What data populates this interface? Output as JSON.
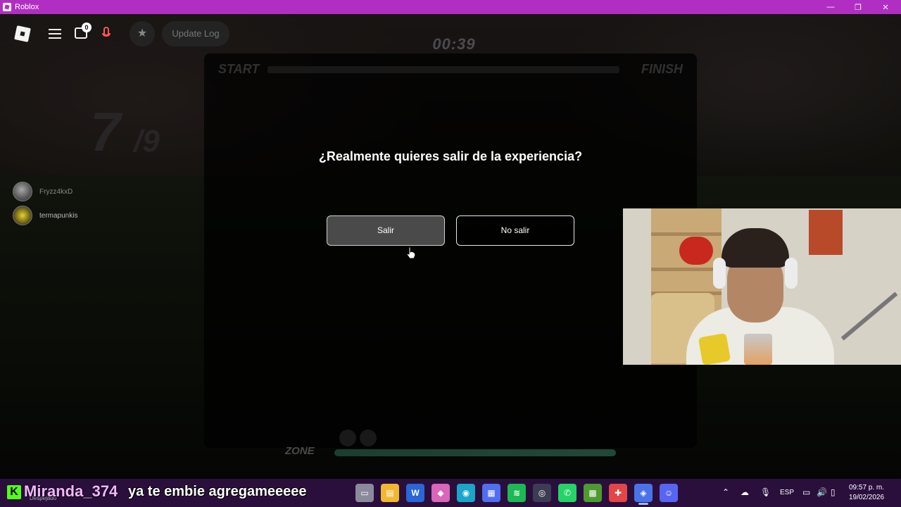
{
  "window": {
    "title": "Roblox",
    "minimize": "—",
    "restore": "❐",
    "close": "✕"
  },
  "hud": {
    "chat_badge": "0",
    "update_log": "Update Log",
    "timer": "00:39",
    "start_label": "START",
    "finish_label": "FINISH",
    "counter_num": "7",
    "counter_den": "/9",
    "zone_label": "ZONE"
  },
  "players": [
    {
      "name": "Fryzz4kxD"
    },
    {
      "name": "termapunkis"
    }
  ],
  "dialog": {
    "title": "¿Realmente quieres salir de la experiencia?",
    "exit_label": "Salir",
    "stay_label": "No salir"
  },
  "stream_chat": {
    "badge": "K",
    "username": "Miranda_374",
    "message": "ya te embie agregameeeee"
  },
  "taskbar": {
    "weather_label": "Despejado",
    "apps": [
      {
        "icon": "file-explorer-icon",
        "color": "#f0b732"
      },
      {
        "icon": "word-icon",
        "color": "#2b66d4"
      },
      {
        "icon": "copilot-icon",
        "color": "#d966b8"
      },
      {
        "icon": "edge-icon",
        "color": "#1aa5c9"
      },
      {
        "icon": "store-icon",
        "color": "#4f6ef0"
      },
      {
        "icon": "spotify-icon",
        "color": "#1db954"
      },
      {
        "icon": "obs-icon",
        "color": "#3c3c52"
      },
      {
        "icon": "whatsapp-icon",
        "color": "#25d366"
      },
      {
        "icon": "minecraft-icon",
        "color": "#4f9a2f"
      },
      {
        "icon": "joystick-icon",
        "color": "#e24646"
      },
      {
        "icon": "roblox-icon",
        "color": "#4a73e8"
      },
      {
        "icon": "discord-icon",
        "color": "#5865f2"
      }
    ],
    "tray": {
      "language": "ESP",
      "time": "09:57 p. m.",
      "date": "19/02/2026"
    }
  }
}
